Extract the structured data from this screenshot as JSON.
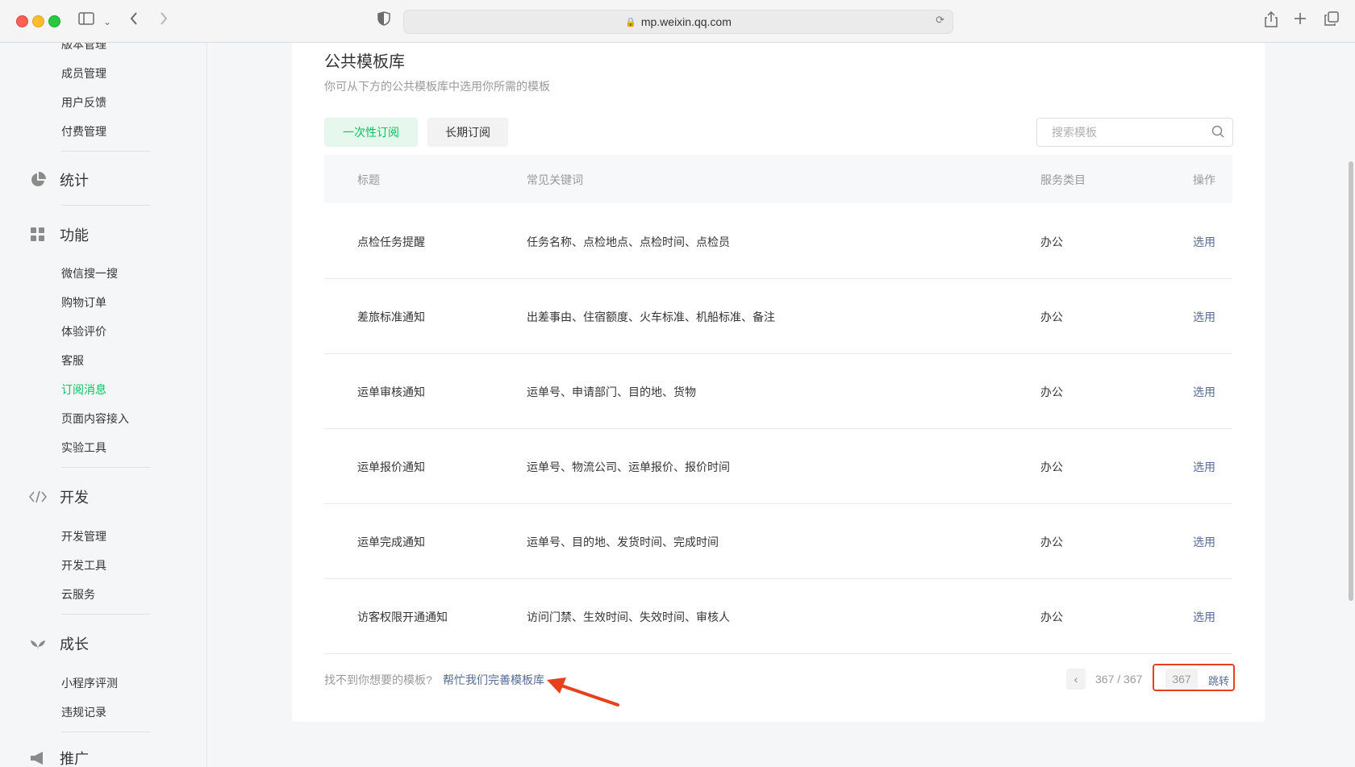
{
  "browser": {
    "url": "mp.weixin.qq.com"
  },
  "sidebar": {
    "top_items": [
      "版本管理",
      "成员管理",
      "用户反馈",
      "付费管理"
    ],
    "sections": [
      {
        "title": "统计",
        "icon": "pie-chart-icon"
      },
      {
        "title": "功能",
        "icon": "grid-icon",
        "items": [
          "微信搜一搜",
          "购物订单",
          "体验评价",
          "客服",
          "订阅消息",
          "页面内容接入",
          "实验工具"
        ]
      },
      {
        "title": "开发",
        "icon": "code-icon",
        "items": [
          "开发管理",
          "开发工具",
          "云服务"
        ]
      },
      {
        "title": "成长",
        "icon": "sprout-icon",
        "items": [
          "小程序评测",
          "违规记录"
        ]
      },
      {
        "title": "推广",
        "icon": "megaphone-icon"
      }
    ],
    "active_item": "订阅消息"
  },
  "main": {
    "title": "公共模板库",
    "description": "你可从下方的公共模板库中选用你所需的模板",
    "tabs": [
      "一次性订阅",
      "长期订阅"
    ],
    "search_placeholder": "搜索模板",
    "table": {
      "headers": [
        "标题",
        "常见关键词",
        "服务类目",
        "操作"
      ],
      "rows": [
        {
          "title": "点检任务提醒",
          "keywords": "任务名称、点检地点、点检时间、点检员",
          "category": "办公",
          "action": "选用"
        },
        {
          "title": "差旅标准通知",
          "keywords": "出差事由、住宿额度、火车标准、机船标准、备注",
          "category": "办公",
          "action": "选用"
        },
        {
          "title": "运单审核通知",
          "keywords": "运单号、申请部门、目的地、货物",
          "category": "办公",
          "action": "选用"
        },
        {
          "title": "运单报价通知",
          "keywords": "运单号、物流公司、运单报价、报价时间",
          "category": "办公",
          "action": "选用"
        },
        {
          "title": "运单完成通知",
          "keywords": "运单号、目的地、发货时间、完成时间",
          "category": "办公",
          "action": "选用"
        },
        {
          "title": "访客权限开通通知",
          "keywords": "访问门禁、生效时间、失效时间、审核人",
          "category": "办公",
          "action": "选用"
        }
      ]
    },
    "footer": {
      "question": "找不到你想要的模板?",
      "help_link": "帮忙我们完善模板库"
    },
    "pagination": {
      "prev_symbol": "‹",
      "page_text": "367 / 367",
      "input_value": "367",
      "go_label": "跳转"
    }
  },
  "colors": {
    "accent_green": "#07c160",
    "link_blue": "#576b95",
    "highlight_red": "#e8401c"
  }
}
